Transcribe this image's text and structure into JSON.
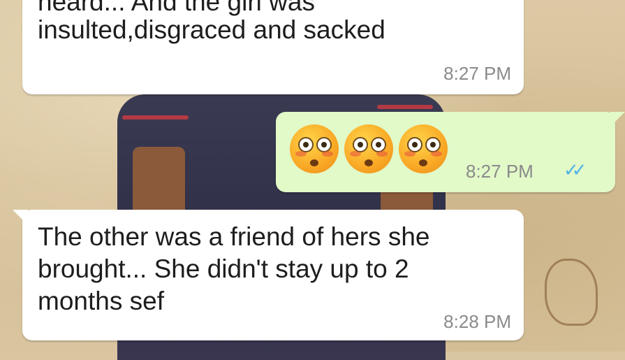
{
  "messages": [
    {
      "id": "m1",
      "direction": "incoming",
      "text": "insulted,disgraced and sacked",
      "partial_text_above": "heard... And the girl was",
      "time": "8:27 PM"
    },
    {
      "id": "m2",
      "direction": "outgoing",
      "emojis": [
        "flushed-face-emoji",
        "flushed-face-emoji",
        "flushed-face-emoji"
      ],
      "time": "8:27 PM",
      "status": "double-check-read"
    },
    {
      "id": "m3",
      "direction": "incoming",
      "text": "The other was a friend of hers she\nbrought... She didn't stay up to 2\nmonths sef",
      "time": "8:28 PM"
    }
  ],
  "colors": {
    "incoming_bubble": "#ffffff",
    "outgoing_bubble": "#e2f9c8",
    "read_ticks": "#4fb3e8",
    "timestamp": "#8a8a8a"
  }
}
